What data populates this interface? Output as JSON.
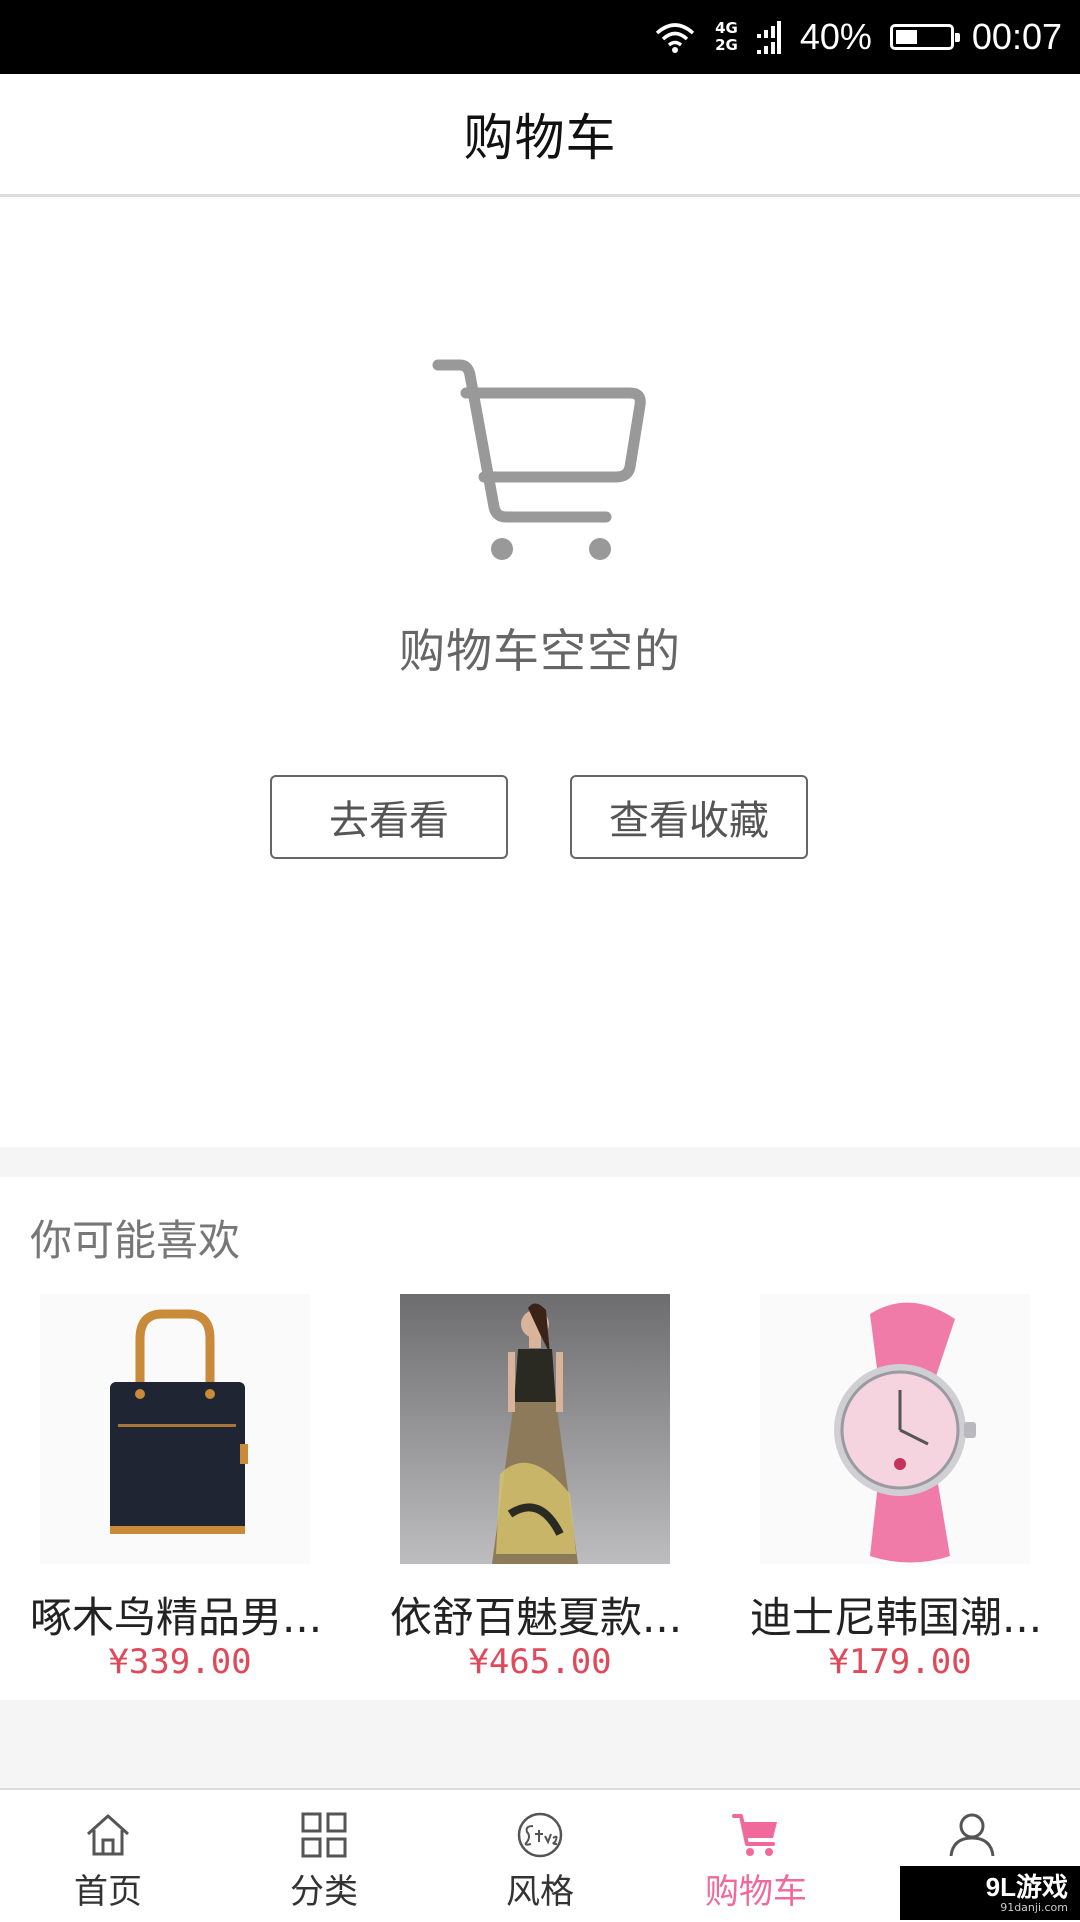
{
  "status_bar": {
    "network_top": "4G",
    "network_bottom": "2G",
    "battery": "40%",
    "battery_level": 0.4,
    "time": "00:07"
  },
  "header": {
    "title": "购物车"
  },
  "empty_cart": {
    "message": "购物车空空的",
    "browse_button": "去看看",
    "favorites_button": "查看收藏"
  },
  "recommendations": {
    "title": "你可能喜欢",
    "items": [
      {
        "name": "啄木鸟精品男...",
        "price": "¥339.00",
        "icon": "handbag-icon"
      },
      {
        "name": "依舒百魅夏款...",
        "price": "¥465.00",
        "icon": "dress-photo"
      },
      {
        "name": "迪士尼韩国潮...",
        "price": "¥179.00",
        "icon": "pink-watch-icon"
      }
    ]
  },
  "tab_bar": {
    "items": [
      {
        "label": "首页",
        "icon": "home-icon"
      },
      {
        "label": "分类",
        "icon": "grid-icon"
      },
      {
        "label": "风格",
        "icon": "style-icon"
      },
      {
        "label": "购物车",
        "icon": "cart-icon",
        "active": true
      },
      {
        "label": "",
        "icon": "user-icon"
      }
    ]
  },
  "colors": {
    "accent_pink": "#f0699a",
    "price_red": "#e0495a",
    "cart_gray": "#999999"
  },
  "watermark": {
    "logo": "9L游戏",
    "url": "91danji.com"
  }
}
